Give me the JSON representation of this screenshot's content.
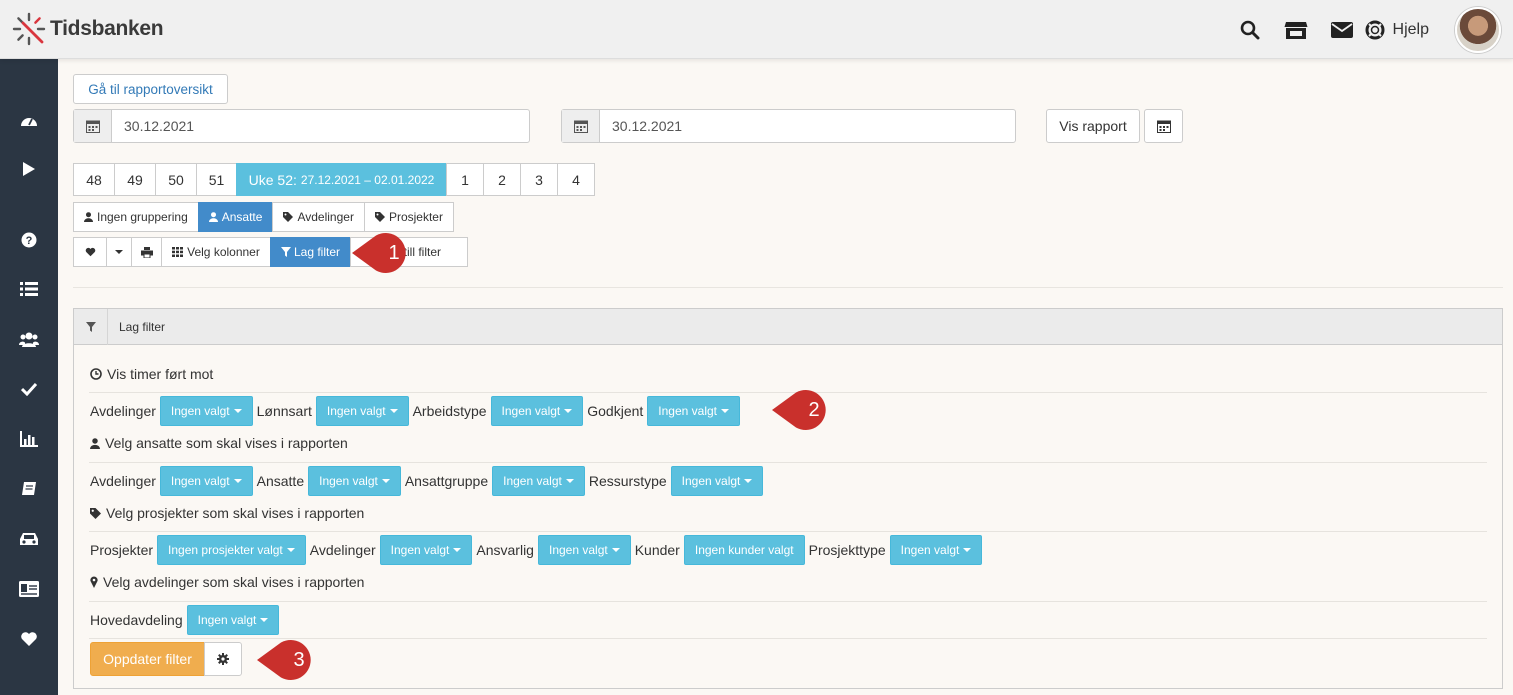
{
  "app": {
    "logo_text": "Tidsbanken"
  },
  "topbar": {
    "help_label": "Hjelp"
  },
  "icons": {
    "search": "search-icon",
    "store": "store-icon",
    "mail": "envelope-icon",
    "help": "lifebuoy-icon",
    "sidebar": [
      "dashboard-icon",
      "play-icon",
      "question-icon",
      "list-icon",
      "users-icon",
      "check-icon",
      "bar-chart-icon",
      "book-icon",
      "car-icon",
      "id-card-icon",
      "heart-icon"
    ]
  },
  "report": {
    "overview_label": "Gå til rapportoversikt",
    "date_from": "30.12.2021",
    "date_to": "30.12.2021",
    "show_report_label": "Vis rapport"
  },
  "weeks": {
    "before": [
      "48",
      "49",
      "50",
      "51"
    ],
    "active_label": "Uke 52:",
    "active_range": "27.12.2021 – 02.01.2022",
    "after": [
      "1",
      "2",
      "3",
      "4"
    ]
  },
  "grouping": [
    "Ingen gruppering",
    "Ansatte",
    "Avdelinger",
    "Prosjekter"
  ],
  "tools": {
    "columns_label": "Velg kolonner",
    "filter_label": "Lag filter",
    "reset_label": "Nullstill filter"
  },
  "panel": {
    "title": "Lag filter",
    "section1": "Vis timer ført mot",
    "row1": [
      {
        "label": "Avdelinger",
        "value": "Ingen valgt"
      },
      {
        "label": "Lønnsart",
        "value": "Ingen valgt"
      },
      {
        "label": "Arbeidstype",
        "value": "Ingen valgt"
      },
      {
        "label": "Godkjent",
        "value": "Ingen valgt"
      }
    ],
    "section2": "Velg ansatte som skal vises i rapporten",
    "row2": [
      {
        "label": "Avdelinger",
        "value": "Ingen valgt"
      },
      {
        "label": "Ansatte",
        "value": "Ingen valgt"
      },
      {
        "label": "Ansattgruppe",
        "value": "Ingen valgt"
      },
      {
        "label": "Ressurstype",
        "value": "Ingen valgt"
      }
    ],
    "section3": "Velg prosjekter som skal vises i rapporten",
    "row3": [
      {
        "label": "Prosjekter",
        "value": "Ingen prosjekter valgt"
      },
      {
        "label": "Avdelinger",
        "value": "Ingen valgt"
      },
      {
        "label": "Ansvarlig",
        "value": "Ingen valgt"
      },
      {
        "label": "Kunder",
        "value": "Ingen kunder valgt"
      },
      {
        "label": "Prosjekttype",
        "value": "Ingen valgt"
      }
    ],
    "section4": "Velg avdelinger som skal vises i rapporten",
    "row4": [
      {
        "label": "Hovedavdeling",
        "value": "Ingen valgt"
      }
    ],
    "update_label": "Oppdater filter"
  },
  "callouts": [
    "1",
    "2",
    "3"
  ],
  "colors": {
    "sidebar": "#2b3643",
    "info": "#5bc0de",
    "primary": "#428bca",
    "warning": "#f0ad4e",
    "callout": "#c9302c"
  }
}
